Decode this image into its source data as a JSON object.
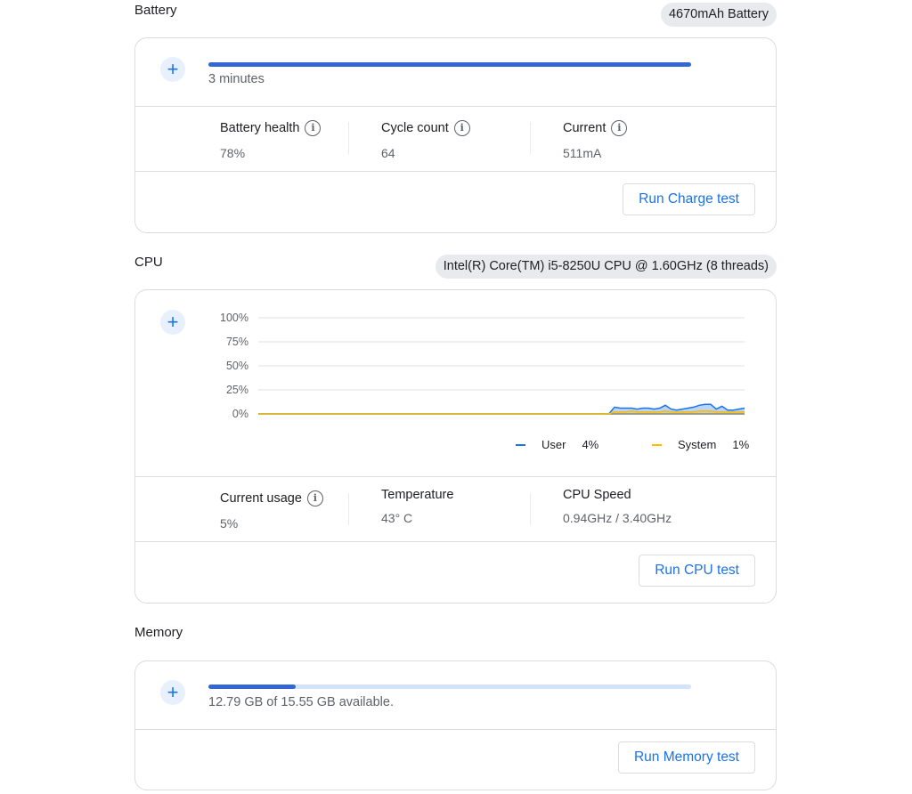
{
  "battery": {
    "title": "Battery",
    "chip": "4670mAh Battery",
    "progress_fraction": 1.0,
    "caption": "3 minutes",
    "stats": [
      {
        "label": "Battery health",
        "value": "78%"
      },
      {
        "label": "Cycle count",
        "value": "64"
      },
      {
        "label": "Current",
        "value": "511mA"
      }
    ],
    "button": "Run Charge test"
  },
  "cpu": {
    "title": "CPU",
    "chip": "Intel(R) Core(TM) i5-8250U CPU @ 1.60GHz (8 threads)",
    "chart_data": {
      "type": "area",
      "y_ticks": [
        "100%",
        "75%",
        "50%",
        "25%",
        "0%"
      ],
      "ylim": [
        0,
        100
      ],
      "grid": true,
      "legend_placement": "bottom-right",
      "series": [
        {
          "name": "User",
          "legend_value": "4%",
          "color": "#1a73e8",
          "values": [
            0,
            0,
            0,
            0,
            0,
            0,
            0,
            0,
            0,
            0,
            0,
            0,
            0,
            0,
            0,
            0,
            0,
            0,
            0,
            0,
            0,
            0,
            0,
            0,
            0,
            0,
            0,
            0,
            0,
            0,
            0,
            0,
            0,
            0,
            0,
            0,
            0,
            0,
            0,
            0,
            0,
            0,
            0,
            0,
            0,
            0,
            0,
            0,
            0,
            0,
            0,
            0,
            0,
            0,
            0,
            0,
            0,
            0,
            0,
            0,
            0,
            0,
            0,
            7,
            6,
            6,
            6,
            5,
            6,
            6,
            5,
            6,
            9,
            5,
            4,
            5,
            6,
            7,
            9,
            10,
            10,
            5,
            8,
            4,
            4,
            5,
            6
          ]
        },
        {
          "name": "System",
          "legend_value": "1%",
          "color": "#fbbc04",
          "values": [
            0,
            0,
            0,
            0,
            0,
            0,
            0,
            0,
            0,
            0,
            0,
            0,
            0,
            0,
            0,
            0,
            0,
            0,
            0,
            0,
            0,
            0,
            0,
            0,
            0,
            0,
            0,
            0,
            0,
            0,
            0,
            0,
            0,
            0,
            0,
            0,
            0,
            0,
            0,
            0,
            0,
            0,
            0,
            0,
            0,
            0,
            0,
            0,
            0,
            0,
            0,
            0,
            0,
            0,
            0,
            0,
            0,
            0,
            0,
            0,
            0,
            0,
            0,
            2,
            2,
            2,
            3,
            2,
            2,
            2,
            2,
            2,
            3,
            2,
            2,
            2,
            2,
            2,
            3,
            3,
            3,
            2,
            2,
            2,
            2,
            2,
            2
          ]
        }
      ]
    },
    "stats": [
      {
        "label": "Current usage",
        "value": "5%"
      },
      {
        "label": "Temperature",
        "value": "43° C"
      },
      {
        "label": "CPU Speed",
        "value": "0.94GHz / 3.40GHz"
      }
    ],
    "button": "Run CPU test"
  },
  "memory": {
    "title": "Memory",
    "progress_fraction": 0.18,
    "caption": "12.79 GB of 15.55 GB available.",
    "button": "Run Memory test"
  },
  "icons": {
    "expand": "+",
    "info": "i"
  }
}
